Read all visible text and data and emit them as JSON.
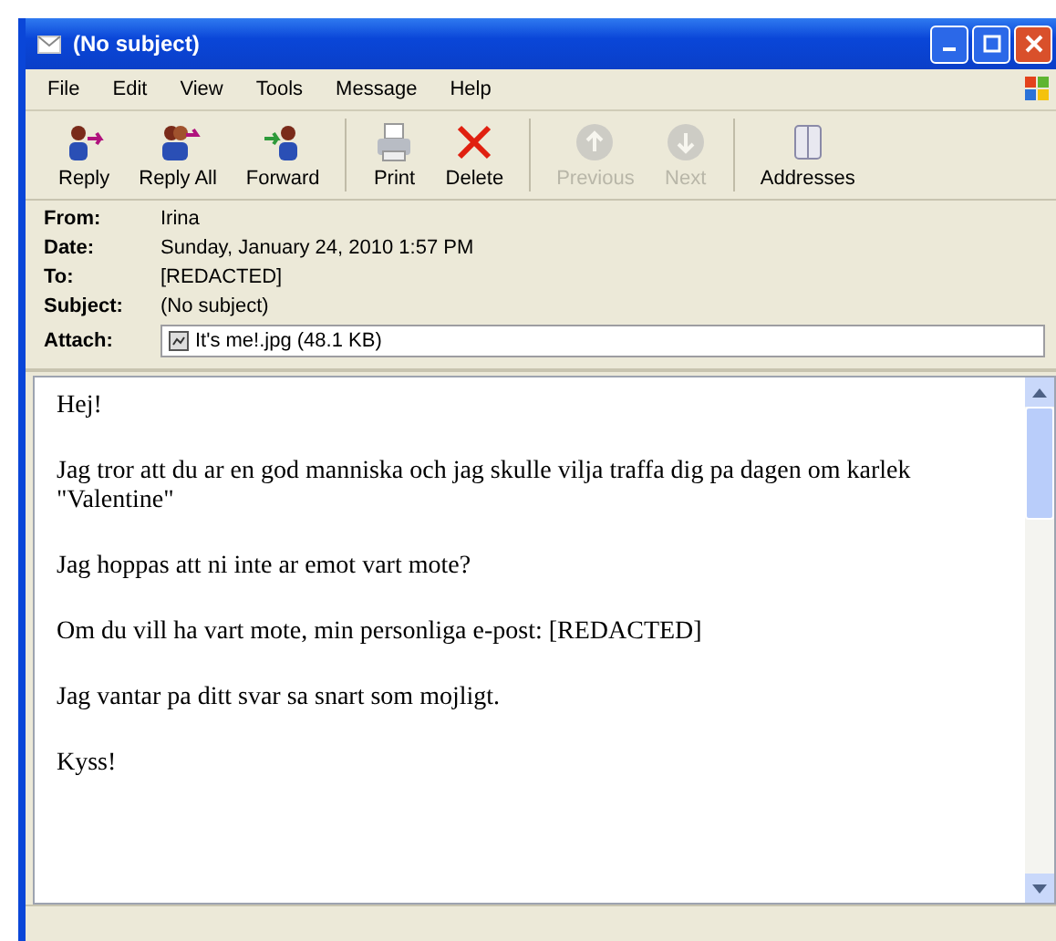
{
  "window": {
    "title": "(No subject)"
  },
  "menu": [
    "File",
    "Edit",
    "View",
    "Tools",
    "Message",
    "Help"
  ],
  "toolbar": [
    [
      {
        "label": "Reply",
        "disabled": false
      },
      {
        "label": "Reply All",
        "disabled": false
      },
      {
        "label": "Forward",
        "disabled": false
      }
    ],
    [
      {
        "label": "Print",
        "disabled": false
      },
      {
        "label": "Delete",
        "disabled": false
      }
    ],
    [
      {
        "label": "Previous",
        "disabled": true
      },
      {
        "label": "Next",
        "disabled": true
      }
    ],
    [
      {
        "label": "Addresses",
        "disabled": false
      }
    ]
  ],
  "header": [
    {
      "label": "From:",
      "value": "Irina"
    },
    {
      "label": "Date:",
      "value": "Sunday, January 24, 2010 1:57 PM"
    },
    {
      "label": "To:",
      "value": "[REDACTED]"
    },
    {
      "label": "Subject:",
      "value": "(No subject)"
    }
  ],
  "attach": {
    "label": "Attach:",
    "file": "It's me!.jpg (48.1 KB)"
  },
  "body": [
    "Hej!",
    "Jag tror att du ar en god manniska och jag skulle vilja traffa dig pa dagen om karlek \"Valentine\"",
    "Jag hoppas att ni inte ar emot vart mote?",
    "Om du vill ha vart mote, min personliga e-post: [REDACTED]",
    "Jag vantar pa ditt svar sa snart som mojligt.",
    "Kyss!"
  ]
}
